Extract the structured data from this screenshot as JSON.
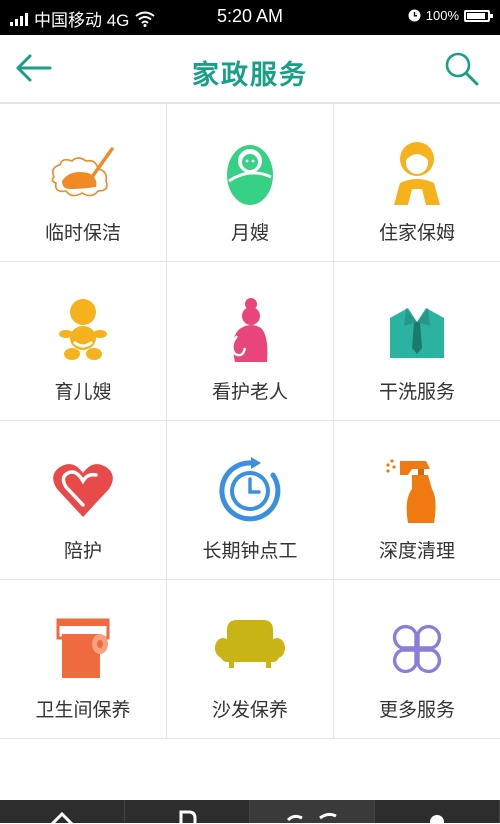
{
  "status_bar": {
    "carrier": "中国移动 4G",
    "time": "5:20 AM",
    "battery_text": "100%",
    "battery_level": 1.0
  },
  "header": {
    "title": "家政服务",
    "back_icon": "arrow-left-icon",
    "search_icon": "search-icon"
  },
  "colors": {
    "accent": "#17a087",
    "orange": "#f08a24",
    "green": "#36d184",
    "yellow": "#f6b21c",
    "pink": "#e8457d",
    "teal": "#2bb3a2",
    "red": "#e84a4a",
    "blue": "#3b8fe0",
    "clean_orange": "#f07a12",
    "coral": "#ee6a3f",
    "olive": "#c9b415",
    "purple": "#8a7ed8"
  },
  "services": [
    {
      "label": "临时保洁",
      "icon": "broom-icon"
    },
    {
      "label": "月嫂",
      "icon": "swaddled-baby-icon"
    },
    {
      "label": "住家保姆",
      "icon": "nanny-icon"
    },
    {
      "label": "育儿嫂",
      "icon": "toddler-icon"
    },
    {
      "label": "看护老人",
      "icon": "elderly-woman-icon"
    },
    {
      "label": "干洗服务",
      "icon": "shirt-tie-icon"
    },
    {
      "label": "陪护",
      "icon": "heart-icon"
    },
    {
      "label": "长期钟点工",
      "icon": "clock-icon"
    },
    {
      "label": "深度清理",
      "icon": "spray-bottle-icon"
    },
    {
      "label": "卫生间保养",
      "icon": "toilet-paper-icon"
    },
    {
      "label": "沙发保养",
      "icon": "sofa-icon"
    },
    {
      "label": "更多服务",
      "icon": "more-grid-icon"
    }
  ],
  "tabbar": {
    "tabs": [
      {
        "icon": "home-icon"
      },
      {
        "icon": "order-icon"
      },
      {
        "icon": "service-icon"
      },
      {
        "icon": "profile-icon"
      }
    ]
  }
}
